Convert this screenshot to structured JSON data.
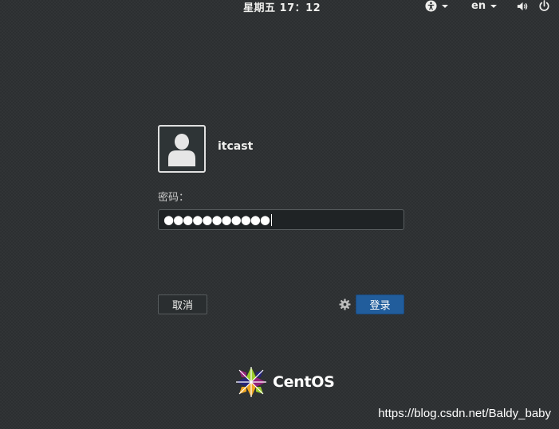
{
  "topbar": {
    "clock": "星期五 17：12",
    "language": "en",
    "icons": [
      "accessibility-icon",
      "volume-icon",
      "power-icon"
    ]
  },
  "user": {
    "name": "itcast",
    "avatar_icon": "user-avatar-icon"
  },
  "password": {
    "label": "密码：",
    "masked_value": "●●●●●●●●●●●"
  },
  "buttons": {
    "cancel": "取消",
    "login": "登录",
    "settings_icon": "gear-icon"
  },
  "footer": {
    "logo_text": "CentOS",
    "watermark": "https://blog.csdn.net/Baldy_baby"
  },
  "colors": {
    "background": "#2c2f31",
    "login_button": "#215d9c",
    "text": "#eeeeec"
  }
}
